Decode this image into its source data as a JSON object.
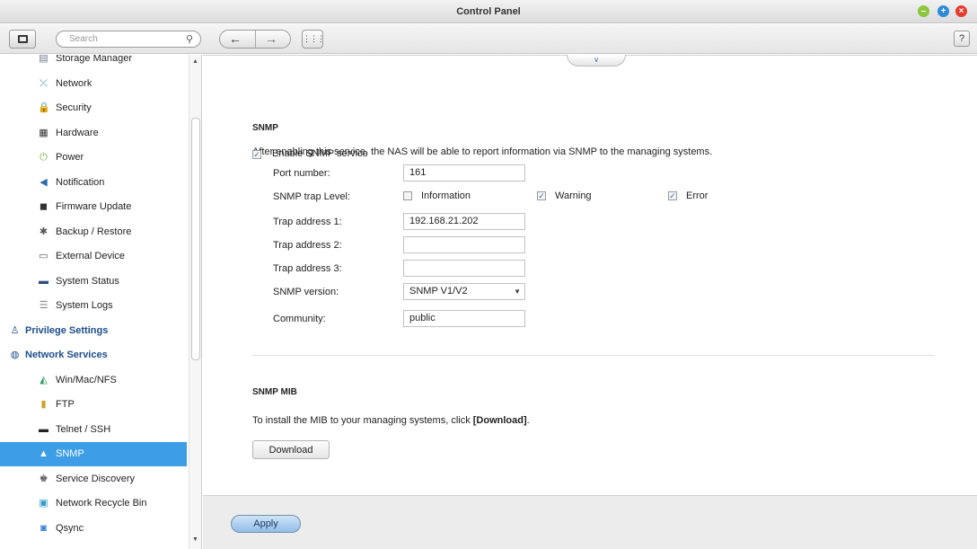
{
  "window": {
    "title": "Control Panel"
  },
  "toolbar": {
    "search_placeholder": "Search",
    "help_label": "?"
  },
  "sidebar": {
    "items": [
      {
        "label": "Storage Manager",
        "icon": "storage-icon",
        "level": "sub"
      },
      {
        "label": "Network",
        "icon": "network-icon",
        "level": "sub"
      },
      {
        "label": "Security",
        "icon": "lock-icon",
        "level": "sub"
      },
      {
        "label": "Hardware",
        "icon": "hardware-icon",
        "level": "sub"
      },
      {
        "label": "Power",
        "icon": "power-icon",
        "level": "sub"
      },
      {
        "label": "Notification",
        "icon": "notification-icon",
        "level": "sub"
      },
      {
        "label": "Firmware Update",
        "icon": "firmware-icon",
        "level": "sub"
      },
      {
        "label": "Backup / Restore",
        "icon": "backup-icon",
        "level": "sub"
      },
      {
        "label": "External Device",
        "icon": "external-device-icon",
        "level": "sub"
      },
      {
        "label": "System Status",
        "icon": "monitor-icon",
        "level": "sub"
      },
      {
        "label": "System Logs",
        "icon": "logs-icon",
        "level": "sub"
      },
      {
        "label": "Privilege Settings",
        "icon": "user-icon",
        "level": "top"
      },
      {
        "label": "Network Services",
        "icon": "globe-icon",
        "level": "top"
      },
      {
        "label": "Win/Mac/NFS",
        "icon": "share-icon",
        "level": "sub"
      },
      {
        "label": "FTP",
        "icon": "ftp-icon",
        "level": "sub"
      },
      {
        "label": "Telnet / SSH",
        "icon": "terminal-icon",
        "level": "sub"
      },
      {
        "label": "SNMP",
        "icon": "snmp-icon",
        "level": "sub",
        "active": true
      },
      {
        "label": "Service Discovery",
        "icon": "discovery-icon",
        "level": "sub"
      },
      {
        "label": "Network Recycle Bin",
        "icon": "recycle-bin-icon",
        "level": "sub"
      },
      {
        "label": "Qsync",
        "icon": "qsync-icon",
        "level": "sub"
      }
    ]
  },
  "snmp": {
    "title": "SNMP",
    "description": "After enabling this service, the NAS will be able to report information via SNMP to the managing systems.",
    "enable_label": "Enable SNMP service",
    "enable_checked": true,
    "port_label": "Port number:",
    "port_value": "161",
    "trap_level_label": "SNMP trap Level:",
    "trap_information": "Information",
    "trap_warning": "Warning",
    "trap_error": "Error",
    "trap_information_checked": false,
    "trap_warning_checked": true,
    "trap_error_checked": true,
    "trap1_label": "Trap address 1:",
    "trap1_value": "192.168.21.202",
    "trap2_label": "Trap address 2:",
    "trap2_value": "",
    "trap3_label": "Trap address 3:",
    "trap3_value": "",
    "version_label": "SNMP version:",
    "version_value": "SNMP V1/V2",
    "community_label": "Community:",
    "community_value": "public"
  },
  "mib": {
    "title": "SNMP MIB",
    "desc_prefix": "To install the MIB to your managing systems, click ",
    "desc_link": "[Download]",
    "desc_suffix": ".",
    "download_label": "Download"
  },
  "footer": {
    "apply_label": "Apply"
  },
  "colors": {
    "accent": "#3d9ee6",
    "nav_header": "#1d4d8c"
  }
}
